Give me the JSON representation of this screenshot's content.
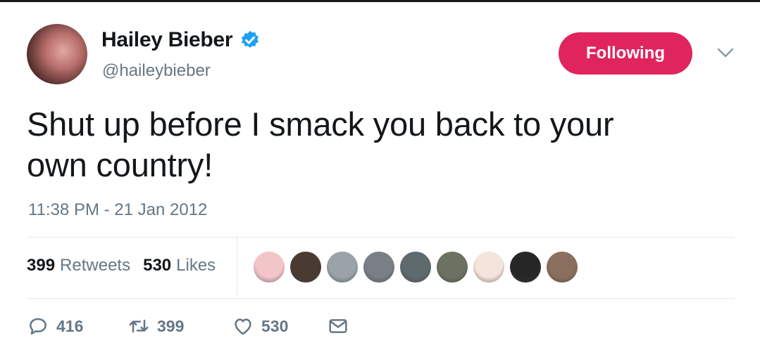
{
  "user": {
    "display_name": "Hailey Bieber",
    "handle": "@haileybieber",
    "verified": true
  },
  "follow_button": {
    "label": "Following",
    "color": "#e0245e"
  },
  "tweet": {
    "line1": "Shut up before I smack you back to your",
    "line2": "own country!",
    "timestamp": "11:38 PM - 21 Jan 2012"
  },
  "stats": {
    "retweets_count": "399",
    "retweets_label": "Retweets",
    "likes_count": "530",
    "likes_label": "Likes"
  },
  "liker_avatars": [
    {
      "color": "#f2c6c9"
    },
    {
      "color": "#4a3b32"
    },
    {
      "color": "#9aa3a8"
    },
    {
      "color": "#7a7f86"
    },
    {
      "color": "#5f6a6e"
    },
    {
      "color": "#6b7262"
    },
    {
      "color": "#f4e4dc"
    },
    {
      "color": "#262626"
    },
    {
      "color": "#8b6f5e"
    }
  ],
  "actions": {
    "reply_count": "416",
    "retweet_count": "399",
    "like_count": "530"
  },
  "colors": {
    "accent": "#e0245e",
    "secondary_text": "#657786",
    "verified_blue": "#1da1f2"
  }
}
